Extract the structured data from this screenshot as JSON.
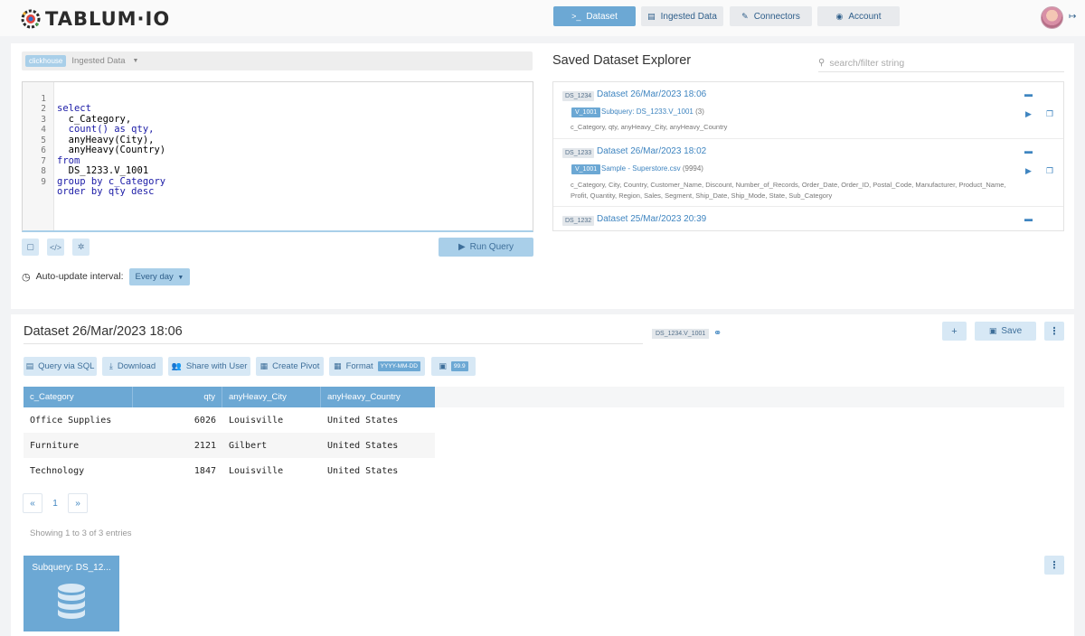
{
  "nav": {
    "brand": "TABLUM·IO",
    "items": [
      {
        "label": "Dataset",
        "icon": "terminal-icon"
      },
      {
        "label": "Ingested Data",
        "icon": "table-icon"
      },
      {
        "label": "Connectors",
        "icon": "plug-icon"
      },
      {
        "label": "Account",
        "icon": "user-circle-icon"
      }
    ]
  },
  "query": {
    "source_tag": "clickhouse",
    "source_label": "Ingested Data",
    "lines": [
      {
        "n": "1",
        "text": "select"
      },
      {
        "n": "2",
        "text": "  c_Category,"
      },
      {
        "n": "3",
        "text": "  count() as qty,"
      },
      {
        "n": "4",
        "text": "  anyHeavy(City),"
      },
      {
        "n": "5",
        "text": "  anyHeavy(Country)"
      },
      {
        "n": "6",
        "text": "from"
      },
      {
        "n": "7",
        "text": "  DS_1233.V_1001"
      },
      {
        "n": "8",
        "text": "group by c_Category"
      },
      {
        "n": "9",
        "text": "order by qty desc"
      }
    ],
    "run_label": "Run Query",
    "auto_label": "Auto-update interval:",
    "auto_value": "Every day"
  },
  "explorer": {
    "title": "Saved Dataset Explorer",
    "search_placeholder": "search/filter string",
    "datasets": [
      {
        "id": "DS_1234",
        "title": "Dataset 26/Mar/2023 18:06",
        "view_id": "V_1001",
        "view_title": "Subquery: DS_1233.V_1001",
        "view_count": "(3)",
        "columns": "c_Category, qty, anyHeavy_City, anyHeavy_Country"
      },
      {
        "id": "DS_1233",
        "title": "Dataset 26/Mar/2023 18:02",
        "view_id": "V_1001",
        "view_title": "Sample - Superstore.csv",
        "view_count": "(9994)",
        "columns": "c_Category, City, Country, Customer_Name, Discount, Number_of_Records, Order_Date, Order_ID, Postal_Code, Manufacturer, Product_Name, Profit, Quantity, Region, Sales, Segment, Ship_Date, Ship_Mode, State, Sub_Category"
      },
      {
        "id": "DS_1232",
        "title": "Dataset 25/Mar/2023 20:39"
      }
    ]
  },
  "dataset": {
    "title": "Dataset 26/Mar/2023 18:06",
    "view_tag": "DS_1234.V_1001",
    "save_label": "Save",
    "toolbar": {
      "query_sql": "Query via SQL",
      "download": "Download",
      "share": "Share with User",
      "pivot": "Create Pivot",
      "format": "Format",
      "format_value": "YYYY-MM-DD",
      "number_value": "99.9"
    },
    "columns": [
      "c_Category",
      "qty",
      "anyHeavy_City",
      "anyHeavy_Country"
    ],
    "rows": [
      [
        "Office Supplies",
        "6026",
        "Louisville",
        "United States"
      ],
      [
        "Furniture",
        "2121",
        "Gilbert",
        "United States"
      ],
      [
        "Technology",
        "1847",
        "Louisville",
        "United States"
      ]
    ],
    "pagination": {
      "prev": "«",
      "page": "1",
      "next": "»"
    },
    "showing": "Showing 1 to 3 of 3 entries",
    "card_title": "Subquery: DS_12..."
  }
}
